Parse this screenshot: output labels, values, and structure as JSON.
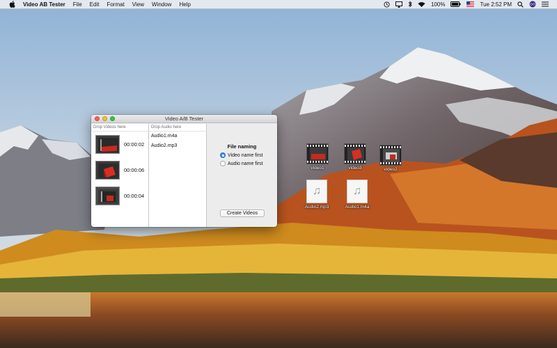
{
  "menubar": {
    "apple_icon": "apple-icon",
    "app_name": "Video AB Tester",
    "menus": [
      "File",
      "Edit",
      "Format",
      "View",
      "Window",
      "Help"
    ],
    "status": {
      "battery": "100%",
      "flag_icon": "us-flag-icon",
      "clock": "Tue 2:52 PM"
    }
  },
  "window": {
    "title": "Video A/B Tester",
    "video_pane": {
      "header": "Drop Videos here",
      "items": [
        {
          "duration": "00:00:02"
        },
        {
          "duration": "00:00:06"
        },
        {
          "duration": "00:00:04"
        }
      ]
    },
    "audio_pane": {
      "header": "Drop Audio here",
      "items": [
        "Audio1.m4a",
        "Audio2.mp3"
      ]
    },
    "options": {
      "naming_title": "File naming",
      "radio_video_first": "Video name first",
      "radio_audio_first": "Audio name first",
      "selected": "video",
      "create_button": "Create Videos"
    }
  },
  "desktop": {
    "icons": [
      {
        "label": "video1",
        "type": "video"
      },
      {
        "label": "video3",
        "type": "video"
      },
      {
        "label": "video2",
        "type": "video"
      },
      {
        "label": "Audio2.mp3",
        "type": "audio"
      },
      {
        "label": "Audio1.m4a",
        "type": "audio"
      }
    ]
  },
  "colors": {
    "accent": "#3b8cf1",
    "close": "#fc5f57",
    "minimize": "#fdbc2e",
    "zoom": "#33c748"
  }
}
